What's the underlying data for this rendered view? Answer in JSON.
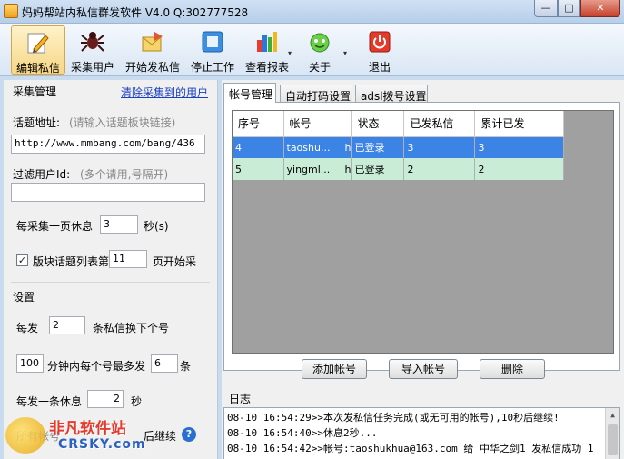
{
  "window": {
    "title": "妈妈帮站内私信群发软件 V4.0 Q:302777528",
    "min_glyph": "—",
    "max_glyph": "□",
    "close_glyph": "✕"
  },
  "toolbar": {
    "items": [
      {
        "label": "编辑私信",
        "icon": "edit-pencil-icon"
      },
      {
        "label": "采集用户",
        "icon": "spider-icon"
      },
      {
        "label": "开始发私信",
        "icon": "send-mail-icon"
      },
      {
        "label": "停止工作",
        "icon": "stop-square-icon"
      },
      {
        "label": "查看报表",
        "icon": "bar-report-icon"
      },
      {
        "label": "关于",
        "icon": "about-smiley-icon"
      },
      {
        "label": "退出",
        "icon": "power-exit-icon"
      }
    ],
    "dropdown_glyph": "▾"
  },
  "collect": {
    "group_title": "采集管理",
    "clear_link": "清除采集到的用户",
    "topic_label": "话题地址:",
    "topic_hint": "(请输入话题板块链接)",
    "topic_value": "http://www.mmbang.com/bang/436",
    "filter_label": "过滤用户Id:",
    "filter_hint": "(多个请用,号隔开)",
    "filter_value": "",
    "rest_prefix": "每采集一页休息",
    "rest_value": "3",
    "rest_suffix": "秒(s)",
    "page_check": "✓",
    "page_prefix": "版块话题列表第",
    "page_value": "11",
    "page_suffix": "页开始采"
  },
  "settings": {
    "group_title": "设置",
    "per_send_prefix": "每发",
    "per_send_value": "2",
    "per_send_suffix": "条私信换下个号",
    "minutes_value": "100",
    "minutes_middle": "分钟内每个号最多发",
    "max_value": "6",
    "max_suffix": "条",
    "rest_prefix": "每发一条休息",
    "rest_value": "2",
    "rest_suffix": "秒",
    "bottom_partial": "所有帐号",
    "bottom_partial2": "后继续",
    "help_glyph": "?"
  },
  "tabs": [
    "帐号管理",
    "自动打码设置",
    "adsl拨号设置"
  ],
  "accounts": {
    "columns": [
      "序号",
      "帐号",
      "",
      "状态",
      "已发私信",
      "累计已发"
    ],
    "rows": [
      [
        "4",
        "taoshu...",
        "h",
        "已登录",
        "3",
        "3"
      ],
      [
        "5",
        "yingml...",
        "h",
        "已登录",
        "2",
        "2"
      ]
    ],
    "add_button": "添加帐号",
    "import_button": "导入帐号",
    "delete_button": "删除"
  },
  "log": {
    "title": "日志",
    "lines": [
      "08-10 16:54:29>>本次发私信任务完成(或无可用的帐号),10秒后继续!",
      "08-10 16:54:40>>休息2秒...",
      "08-10 16:54:42>>帐号:taoshukhua@163.com 给 中华之剑1 发私信成功 1"
    ]
  },
  "watermark": {
    "text_cn": "非凡软件站",
    "text_en": "CRSKY.com"
  }
}
